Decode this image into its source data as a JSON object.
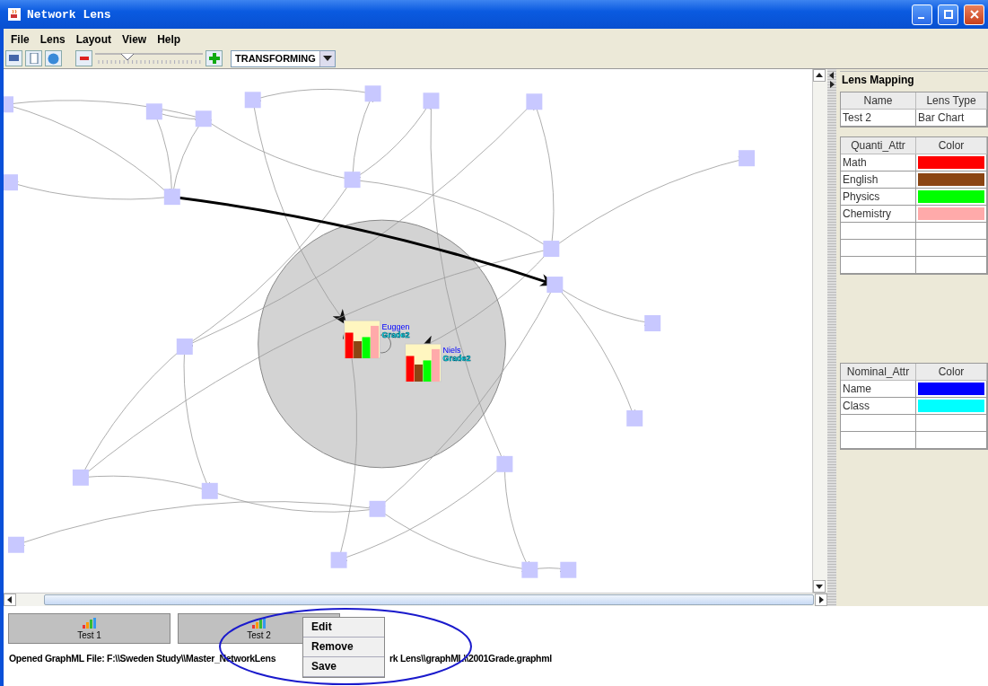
{
  "window": {
    "title": "Network Lens"
  },
  "menu": [
    "File",
    "Lens",
    "Layout",
    "View",
    "Help"
  ],
  "toolbar": {
    "zoom_slider": {
      "level": 0.3
    },
    "mode": "TRANSFORMING"
  },
  "lens_nodes": [
    {
      "name": "Euggen",
      "class": "Grade2"
    },
    {
      "name": "Niels",
      "class": "Grade2"
    }
  ],
  "lens_mapping": {
    "title": "Lens Mapping",
    "lens_table": {
      "columns": [
        "Name",
        "Lens Type"
      ],
      "rows": [
        [
          "Test 2",
          "Bar Chart"
        ]
      ]
    },
    "quantitative_table": {
      "columns": [
        "Quanti_Attr",
        "Color"
      ],
      "rows": [
        {
          "name": "Math",
          "color": "#ff0000"
        },
        {
          "name": "English",
          "color": "#8b4513"
        },
        {
          "name": "Physics",
          "color": "#00ff00"
        },
        {
          "name": "Chemistry",
          "color": "#ffaaaa"
        }
      ]
    },
    "nominal_table": {
      "columns": [
        "Nominal_Attr",
        "Color"
      ],
      "rows": [
        {
          "name": "Name",
          "color": "#0000ff"
        },
        {
          "name": "Class",
          "color": "#00ffff"
        }
      ]
    }
  },
  "lens_buttons": [
    "Test 1",
    "Test 2"
  ],
  "context_menu": [
    "Edit",
    "Remove",
    "Save"
  ],
  "status_bar": [
    "Opened GraphML File: F:\\\\Sweden Study\\\\Master_NetworkLens",
    "rk Lens\\\\graphML\\\\2001Grade.graphml"
  ]
}
